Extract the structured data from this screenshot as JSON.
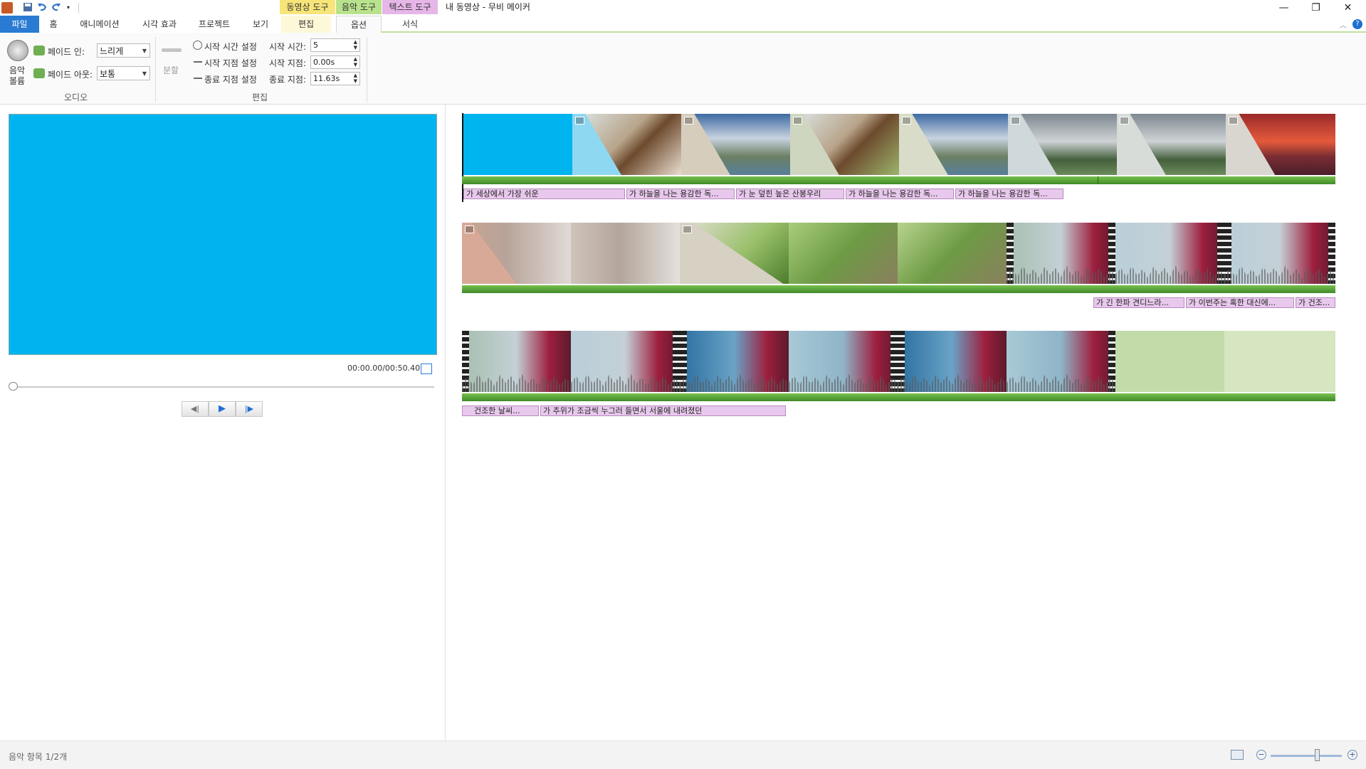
{
  "window": {
    "title": "내 동영상 - 무비 메이커",
    "tool_tabs": [
      {
        "label": "동영상 도구",
        "color": "#f7e57a"
      },
      {
        "label": "음악 도구",
        "color": "#b9e28c"
      },
      {
        "label": "텍스트 도구",
        "color": "#e6b6e8"
      }
    ],
    "minimize": "—",
    "restore": "❐",
    "close": "✕"
  },
  "ribbon_tabs": [
    "파일",
    "홈",
    "애니메이션",
    "시각 효과",
    "프로젝트",
    "보기",
    "편집",
    "옵션",
    "서식"
  ],
  "ribbon": {
    "audio": {
      "volume_label_1": "음악",
      "volume_label_2": "볼륨",
      "fade_in_label": "페이드 인:",
      "fade_in_value": "느리게",
      "fade_out_label": "페이드 아웃:",
      "fade_out_value": "보통",
      "group_label": "오디오"
    },
    "edit": {
      "split_label": "분할",
      "set_start_time": "시작 시간 설정",
      "set_start_point": "시작 지점 설정",
      "set_end_point": "종료 지점 설정",
      "start_time_label": "시작 시간:",
      "start_time_value": "5",
      "start_point_label": "시작 지점:",
      "start_point_value": "0.00s",
      "end_point_label": "종료 지점:",
      "end_point_value": "11.63s",
      "group_label": "편집"
    }
  },
  "preview": {
    "screen_color": "#00b4ef",
    "time": "00:00.00/00:50.40",
    "prev_frame": "◀|",
    "play": "▶",
    "next_frame": "|▶"
  },
  "captions_row1": [
    "가 세상에서 가장 쉬운",
    "가 하늘을 나는 용감한 독...",
    "가 눈 덮힌 높은 산봉우리",
    "가 하늘을 나는 용감한 독...",
    "가 하늘을 나는 용감한 독..."
  ],
  "captions_row2": [
    "가 긴 한파 견디느라...",
    "가 이번주는 혹한 대신에...",
    "가 건조..."
  ],
  "captions_row3": [
    "건조한 날씨...",
    "가 추위가 조금씩 누그러 들면서 서울에 내려졌던"
  ],
  "status": {
    "text": "음악 항목 1/2개",
    "zoom_out": "−",
    "zoom_in": "+"
  }
}
